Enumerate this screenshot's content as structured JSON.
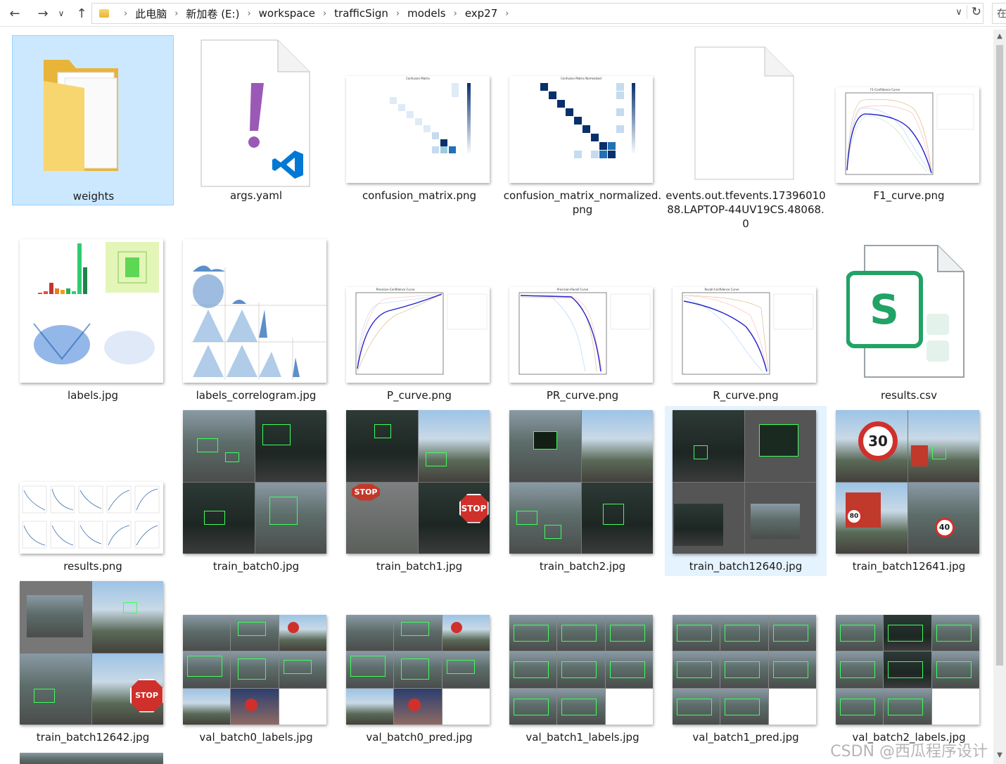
{
  "address_bar": {
    "breadcrumbs": [
      "此电脑",
      "新加卷 (E:)",
      "workspace",
      "trafficSign",
      "models",
      "exp27"
    ],
    "search_placeholder": "在"
  },
  "files": [
    {
      "name": "weights",
      "type": "folder",
      "selected": true
    },
    {
      "name": "args.yaml",
      "type": "yaml"
    },
    {
      "name": "confusion_matrix.png",
      "type": "matrix"
    },
    {
      "name": "confusion_matrix_normalized.png",
      "type": "matrix-norm"
    },
    {
      "name": "events.out.tfevents.1739601088.LAPTOP-44UV19CS.48068.0",
      "type": "blank"
    },
    {
      "name": "F1_curve.png",
      "type": "curve"
    },
    {
      "name": "labels.jpg",
      "type": "labels"
    },
    {
      "name": "labels_correlogram.jpg",
      "type": "correlogram"
    },
    {
      "name": "P_curve.png",
      "type": "curve"
    },
    {
      "name": "PR_curve.png",
      "type": "curve"
    },
    {
      "name": "R_curve.png",
      "type": "curve"
    },
    {
      "name": "results.csv",
      "type": "csv"
    },
    {
      "name": "results.png",
      "type": "results"
    },
    {
      "name": "train_batch0.jpg",
      "type": "batch4"
    },
    {
      "name": "train_batch1.jpg",
      "type": "batch4"
    },
    {
      "name": "train_batch2.jpg",
      "type": "batch4"
    },
    {
      "name": "train_batch12640.jpg",
      "type": "batch4",
      "hovered": true
    },
    {
      "name": "train_batch12641.jpg",
      "type": "batch4"
    },
    {
      "name": "train_batch12642.jpg",
      "type": "batch4"
    },
    {
      "name": "val_batch0_labels.jpg",
      "type": "batch9"
    },
    {
      "name": "val_batch0_pred.jpg",
      "type": "batch9"
    },
    {
      "name": "val_batch1_labels.jpg",
      "type": "batch9"
    },
    {
      "name": "val_batch1_pred.jpg",
      "type": "batch9"
    },
    {
      "name": "val_batch2_labels.jpg",
      "type": "batch9"
    }
  ],
  "thumb_text": {
    "confusion_title": "Confusion Matrix",
    "confusion_norm_title": "Confusion Matrix Normalized",
    "f1_title": "F1-Confidence Curve",
    "p_title": "Precision-Confidence Curve",
    "pr_title": "Precision-Recall Curve",
    "r_title": "Recall-Confidence Curve",
    "stop_sign": "STOP",
    "speed_30": "30",
    "speed_80": "80",
    "speed_40": "40"
  },
  "icons": {
    "back": "back-arrow-icon",
    "forward": "forward-arrow-icon",
    "recent": "chevron-down-icon",
    "up": "up-arrow-icon",
    "refresh": "refresh-icon",
    "vscode": "vscode-icon",
    "spreadsheet": "wps-spreadsheet-icon"
  },
  "watermark": "CSDN @西瓜程序设计",
  "colors": {
    "selection_bg": "#cce8ff",
    "hover_bg": "#e5f3ff",
    "folder": "#f2c94c",
    "vscode_blue": "#0078d4",
    "csv_green": "#21a366",
    "box_green": "#3cff5a"
  }
}
